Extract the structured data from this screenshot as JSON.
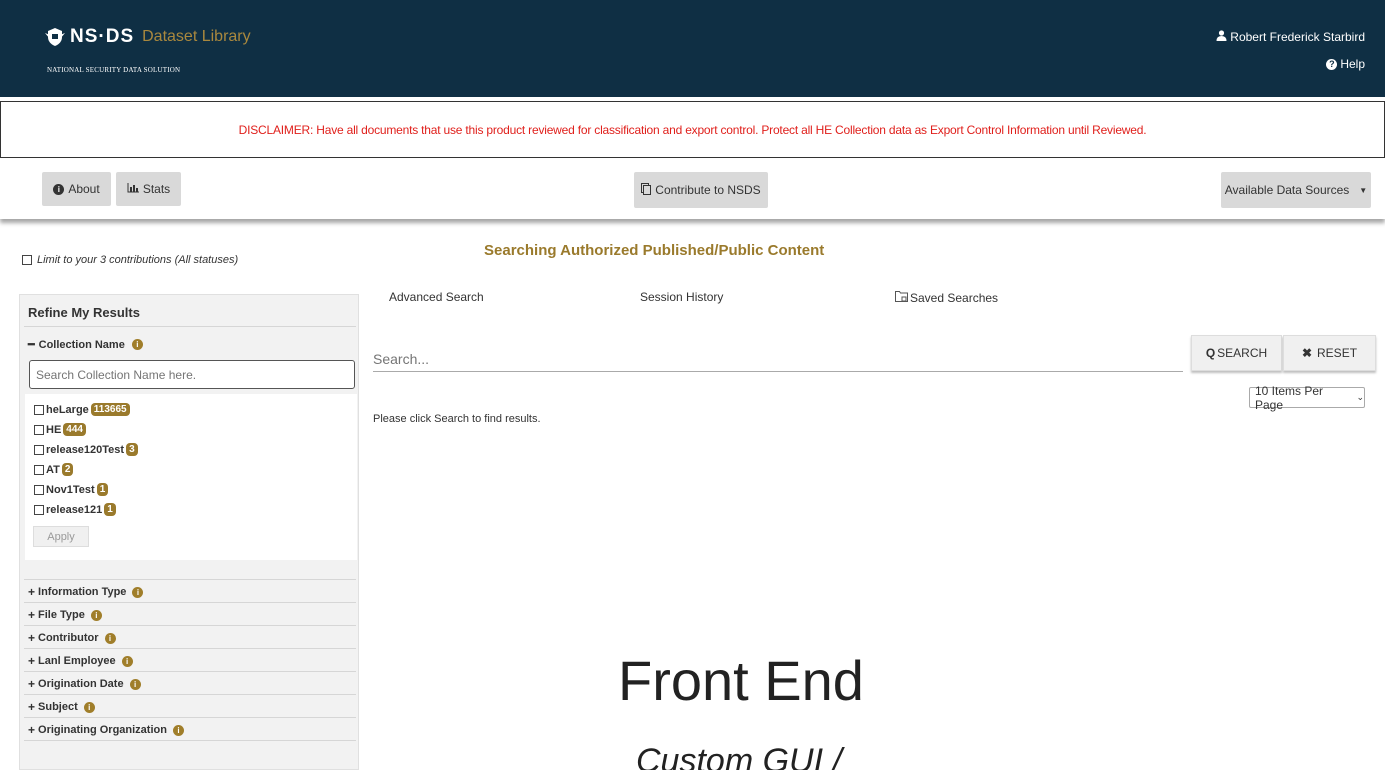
{
  "header": {
    "logo_name": "NS·DS",
    "logo_subtitle": "Dataset Library",
    "logo_tagline": "NATIONAL SECURITY DATA SOLUTION",
    "user_name": "Robert Frederick Starbird",
    "help_label": "Help"
  },
  "disclaimer": {
    "text": "DISCLAIMER: Have all documents that use this product reviewed for classification and export control. Protect all HE Collection data as Export Control Information until Reviewed."
  },
  "navbar": {
    "about_label": "About",
    "stats_label": "Stats",
    "contribute_label": "Contribute to NSDS",
    "sources_label": "Available Data Sources"
  },
  "sidebar": {
    "limit_label": "Limit to your 3 contributions (All statuses)",
    "refine_title": "Refine My Results",
    "collection_heading": "Collection Name",
    "collection_search_placeholder": "Search Collection Name here.",
    "collections": [
      {
        "name": "heLarge",
        "count": "113665"
      },
      {
        "name": "HE",
        "count": "444"
      },
      {
        "name": "release120Test",
        "count": "3"
      },
      {
        "name": "AT",
        "count": "2"
      },
      {
        "name": "Nov1Test",
        "count": "1"
      },
      {
        "name": "release121",
        "count": "1"
      }
    ],
    "apply_label": "Apply",
    "facets": [
      "Information Type",
      "File Type",
      "Contributor",
      "Lanl Employee",
      "Origination Date",
      "Subject",
      "Originating Organization"
    ]
  },
  "main": {
    "searching_title": "Searching Authorized Published/Public Content",
    "advanced_search": "Advanced Search",
    "session_history": "Session History",
    "saved_searches": "Saved Searches",
    "search_placeholder": "Search...",
    "search_button_q": "Q",
    "search_button": "SEARCH",
    "reset_button": "RESET",
    "items_per_page": "10 Items Per Page",
    "prompt": "Please click Search to find results."
  },
  "overlay": {
    "title": "Front End",
    "subtitle": "Custom GUI /"
  },
  "colors": {
    "header_bg": "#0f2f44",
    "accent_gold": "#9a7a2c",
    "disclaimer_red": "#e0201c"
  }
}
